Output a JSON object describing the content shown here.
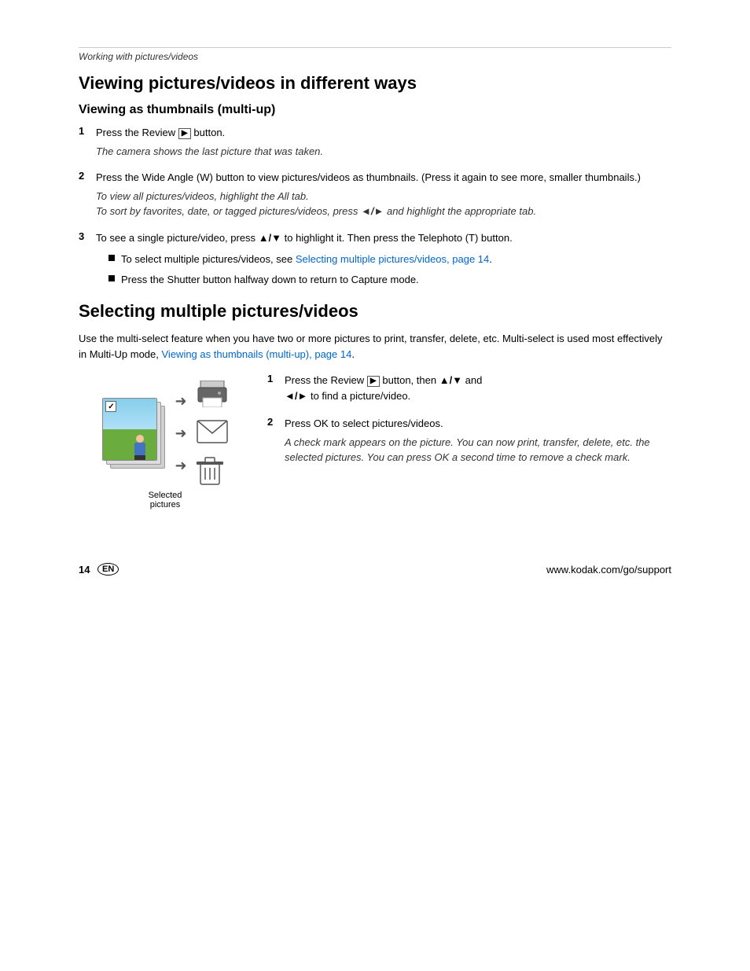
{
  "breadcrumb": "Working with pictures/videos",
  "section1": {
    "title": "Viewing pictures/videos in different ways",
    "subsection1": {
      "title": "Viewing as thumbnails (multi-up)",
      "steps": [
        {
          "number": "1",
          "text": "Press the Review",
          "text2": "button.",
          "note": "The camera shows the last picture that was taken."
        },
        {
          "number": "2",
          "text": "Press the Wide Angle (W) button to view pictures/videos as thumbnails. (Press it again to see more, smaller thumbnails.)",
          "note": "To view all pictures/videos, highlight the All tab.",
          "note2": "To sort by favorites, date, or tagged pictures/videos, press",
          "note2b": "and highlight the appropriate tab."
        },
        {
          "number": "3",
          "text": "To see a single picture/video, press",
          "text2": "to highlight it. Then press the Telephoto (T) button.",
          "bullets": [
            {
              "text_before": "To select multiple pictures/videos, see ",
              "link": "Selecting multiple pictures/videos, page 14",
              "text_after": "."
            },
            {
              "text": "Press the Shutter button halfway down to return to Capture mode."
            }
          ]
        }
      ]
    }
  },
  "section2": {
    "title": "Selecting multiple pictures/videos",
    "intro": "Use the multi-select feature when you have two or more pictures to print, transfer, delete, etc. Multi-select is used most effectively in Multi-Up mode,",
    "intro_link": "Viewing as thumbnails (multi-up), page 14",
    "intro_end": ".",
    "caption": "Selected\npictures",
    "steps": [
      {
        "number": "1",
        "text": "Press the Review",
        "text2": "button, then",
        "text3": "and",
        "text4": "to find a picture/video."
      },
      {
        "number": "2",
        "text": "Press OK to select pictures/videos.",
        "note": "A check mark appears on the picture. You can now print, transfer, delete, etc. the selected pictures. You can press OK a second time to remove a check mark."
      }
    ]
  },
  "footer": {
    "page_number": "14",
    "badge": "EN",
    "url": "www.kodak.com/go/support"
  }
}
